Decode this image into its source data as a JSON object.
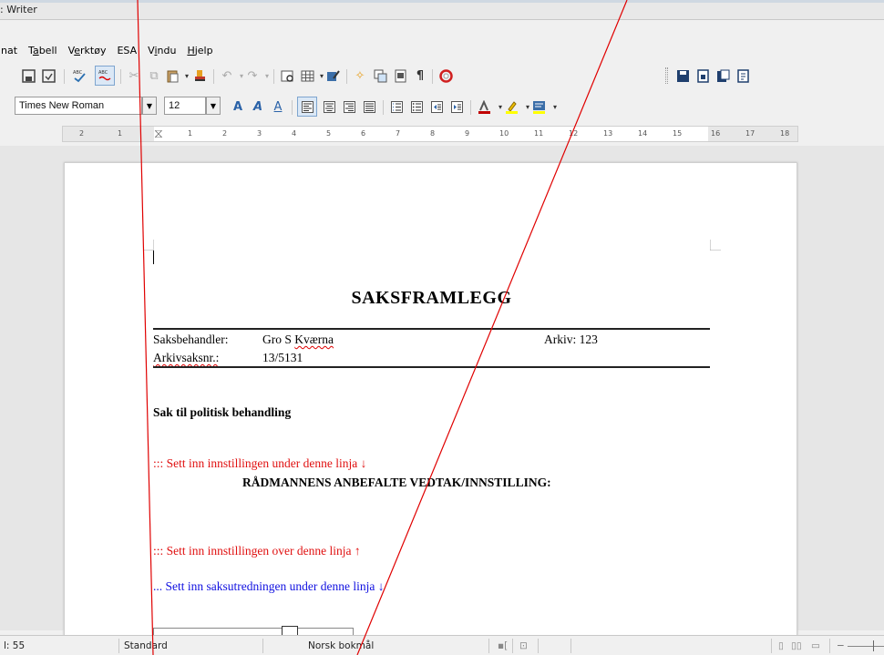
{
  "window": {
    "title": ": Writer"
  },
  "menu": [
    "nat",
    "Tabell",
    "Verktøy",
    "ESA",
    "Vindu",
    "Hjelp"
  ],
  "toolbar": {
    "font_name": "Times New Roman",
    "font_size": "12"
  },
  "ruler": {
    "labels": [
      "2",
      "1",
      "1",
      "2",
      "3",
      "4",
      "5",
      "6",
      "7",
      "8",
      "9",
      "10",
      "11",
      "12",
      "13",
      "14",
      "15",
      "16",
      "17",
      "18"
    ]
  },
  "document": {
    "heading": "SAKSFRAMLEGG",
    "saksbehandler_label": "Saksbehandler:",
    "saksbehandler_value_a": "Gro S ",
    "saksbehandler_value_b": "Kværna",
    "arkiv_label": "Arkiv: 123",
    "arkivsaksnr_label": "Arkivsaksnr.:",
    "arkivsaksnr_value": "13/5131",
    "section_heading": "Sak til politisk behandling",
    "red_line_1": "::: Sett inn innstillingen under denne linja",
    "red_arrow_1": "↓",
    "innstilling_heading": "RÅDMANNENS ANBEFALTE VEDTAK/INNSTILLING:",
    "red_line_2": "::: Sett inn innstillingen over denne linja",
    "red_arrow_2": "↑",
    "blue_line": "... Sett inn saksutredningen under denne linja",
    "blue_arrow": "↓"
  },
  "statusbar": {
    "page": "l: 55",
    "style": "Standard",
    "language": "Norsk bokmål"
  },
  "colors": {
    "red_text": "#e01010",
    "blue_text": "#1010e0",
    "annotation_line": "#e00000"
  }
}
